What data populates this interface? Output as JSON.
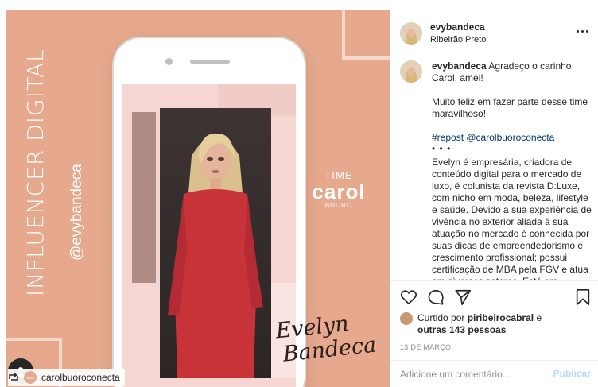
{
  "poster": {
    "vertical_title": "INFLUENCER DIGITAL",
    "vertical_handle": "@evybandeca",
    "time_label": "TIME",
    "brand_name": "carol",
    "brand_sub": "BUORO",
    "signature_line1": "Evelyn",
    "signature_line2": "Bandeca",
    "background_color": "#e6a98e"
  },
  "image_tag": {
    "username": "carolbuoroconecta",
    "tag_avatar_text": "carol"
  },
  "post_header": {
    "username": "evybandeca",
    "location": "Ribeirão Preto",
    "more_icon": "more-horizontal-icon"
  },
  "caption": {
    "username": "evybandeca",
    "line1": "Agradeço o carinho Carol, amei!",
    "line2": "Muito feliz em fazer parte desse time maravilhoso!",
    "repost_tag": "#repost",
    "repost_user": "@carolbuoroconecta",
    "dots": "• • •",
    "body": "Evelyn é empresária, criadora de conteúdo digital para o mercado de luxo, é colunista da revista D:Luxe, com nicho em moda, beleza, lifestyle e saúde. Devido a sua experiência de vivência no exterior aliada à sua atuação no mercado é conhecida por suas dicas de empreendedorismo e crescimento profissional; possui certificação de MBA pela FGV e atua em diversos setores. Está em expansão"
  },
  "actions": {
    "like_icon": "heart-icon",
    "comment_icon": "comment-icon",
    "share_icon": "share-icon",
    "save_icon": "bookmark-icon"
  },
  "likes": {
    "prefix": "Curtido por",
    "user": "piribeirocabral",
    "conjunction": "e",
    "others": "outras 143 pessoas"
  },
  "date": "13 DE MARÇO",
  "comment": {
    "placeholder": "Adicione um comentário...",
    "publish_label": "Publicar"
  }
}
